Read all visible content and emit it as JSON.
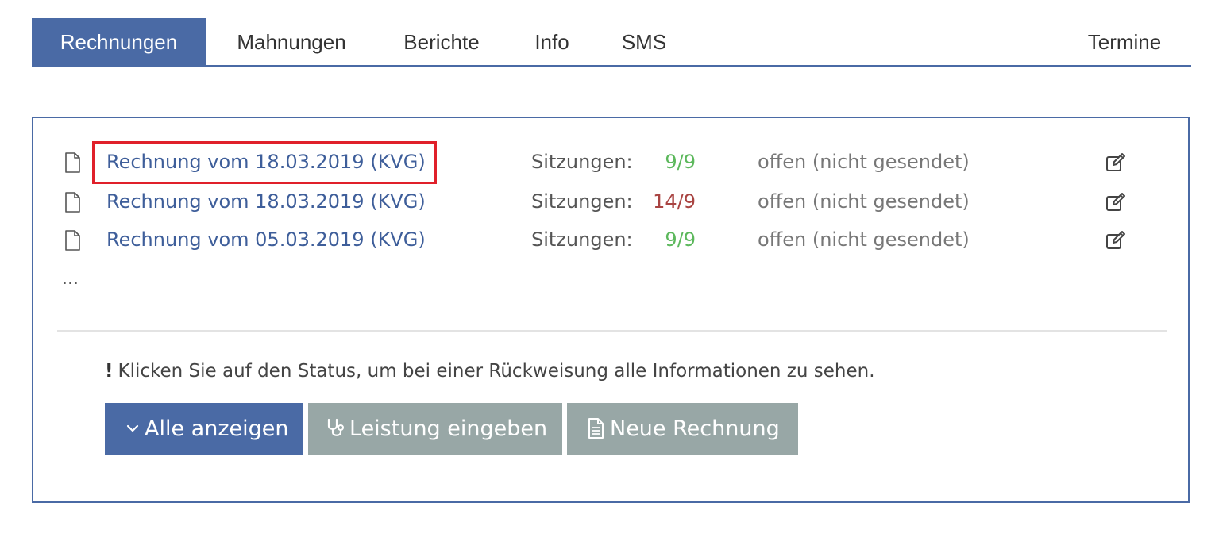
{
  "tabs": [
    {
      "label": "Rechnungen",
      "active": true
    },
    {
      "label": "Mahnungen",
      "active": false
    },
    {
      "label": "Berichte",
      "active": false
    },
    {
      "label": "Info",
      "active": false
    },
    {
      "label": "SMS",
      "active": false
    },
    {
      "label": "Termine",
      "active": false
    }
  ],
  "invoices": [
    {
      "title": "Rechnung vom 18.03.2019 (KVG)",
      "sessions_label": "Sitzungen:",
      "sessions": "9/9",
      "sessions_color": "#5cb85c",
      "status": "offen (nicht gesendet)"
    },
    {
      "title": "Rechnung vom 18.03.2019 (KVG)",
      "sessions_label": "Sitzungen:",
      "sessions": "14/9",
      "sessions_color": "#a94442",
      "status": "offen (nicht gesendet)"
    },
    {
      "title": "Rechnung vom 05.03.2019 (KVG)",
      "sessions_label": "Sitzungen:",
      "sessions": "9/9",
      "sessions_color": "#5cb85c",
      "status": "offen (nicht gesendet)"
    }
  ],
  "more_indicator": "...",
  "info_text": "Klicken Sie auf den Status, um bei einer Rückweisung alle Informationen zu sehen.",
  "info_mark": "!",
  "buttons": {
    "show_all": "Alle anzeigen",
    "enter_service": "Leistung eingeben",
    "new_invoice": "Neue Rechnung"
  },
  "colors": {
    "accent": "#4a6aa5",
    "link": "#3e5e9a",
    "secondary_button": "#98a7a6",
    "highlight": "#e0202a"
  },
  "icons": {
    "row_icon": "document-icon",
    "row_action": "edit-icon",
    "show_all": "chevron-down-icon",
    "enter_service": "stethoscope-icon",
    "new_invoice": "document-text-icon"
  }
}
